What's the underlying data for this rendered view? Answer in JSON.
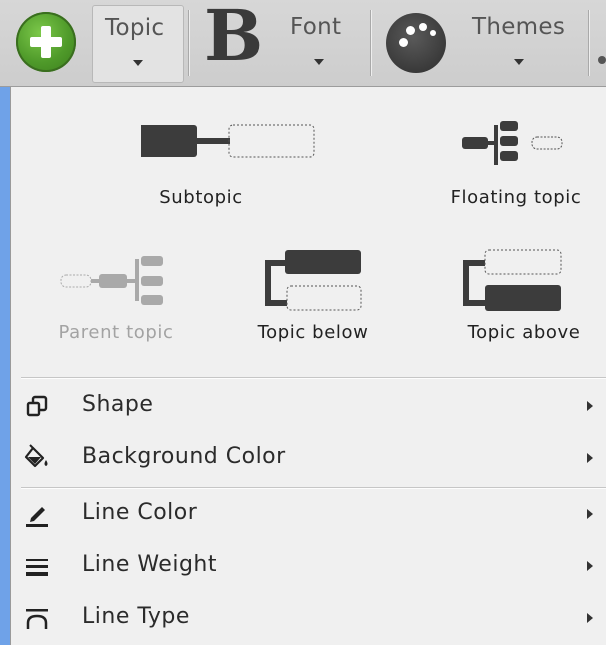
{
  "toolbar": {
    "add_icon": "add-circle-icon",
    "topic_label": "Topic",
    "font_label": "Font",
    "themes_label": "Themes",
    "accent_color": "#4f9a2a"
  },
  "insert_options": [
    {
      "id": "subtopic",
      "label": "Subtopic",
      "enabled": true
    },
    {
      "id": "floating-topic",
      "label": "Floating topic",
      "enabled": true
    },
    {
      "id": "parent-topic",
      "label": "Parent topic",
      "enabled": false
    },
    {
      "id": "topic-below",
      "label": "Topic below",
      "enabled": true
    },
    {
      "id": "topic-above",
      "label": "Topic above",
      "enabled": true
    }
  ],
  "menu_items": [
    {
      "label": "Shape",
      "icon": "shape-icon"
    },
    {
      "label": "Background Color",
      "icon": "paint-bucket-icon"
    },
    {
      "label": "Line Color",
      "icon": "line-color-icon"
    },
    {
      "label": "Line Weight",
      "icon": "line-weight-icon"
    },
    {
      "label": "Line Type",
      "icon": "line-type-icon"
    }
  ]
}
